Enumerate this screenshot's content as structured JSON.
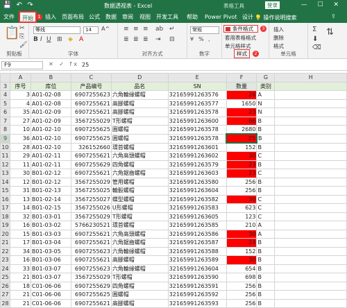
{
  "title_bar": {
    "quick_access": "💾 ↶ ↷",
    "title": "数据透视表 - Excel",
    "context_tool": "表格工具",
    "login": "登录",
    "window_controls": "— ☐ ✕"
  },
  "tabs": [
    "文件",
    "开始",
    "插入",
    "页面布局",
    "公式",
    "数据",
    "审阅",
    "视图",
    "开发工具",
    "帮助",
    "Power Pivot",
    "设计"
  ],
  "active_tab": "开始",
  "help": "操作说明搜索",
  "share_icon": "share-icon",
  "ribbon": {
    "font_name": "等线",
    "font_size": "14",
    "number_format": "常规",
    "groups": [
      "剪贴板",
      "字体",
      "对齐方式",
      "数字",
      "样式",
      "单元格"
    ],
    "conditional_format": "条件格式",
    "table_format": "套用表格格式",
    "cell_styles": "单元格样式",
    "insert": "插入",
    "delete": "删除",
    "format": "格式",
    "badges": [
      "1",
      "2",
      "3"
    ]
  },
  "formula_bar": {
    "name_box": "F9",
    "fx": "✕ ✓ fx",
    "value": "25"
  },
  "columns": [
    "",
    "A",
    "B",
    "C",
    "D",
    "E",
    "F",
    "G",
    "H"
  ],
  "header_row": {
    "num": "3",
    "cells": [
      "序号",
      "库位",
      "产品编号",
      "品名",
      "SN",
      "数量",
      "类别",
      ""
    ]
  },
  "rows": [
    {
      "n": "4",
      "c": [
        "3",
        "A01-02-08",
        "6907255623",
        "六角輪緣螺帽",
        "32165991263576",
        "26",
        "A",
        ""
      ],
      "red": true
    },
    {
      "n": "5",
      "c": [
        "4",
        "A01-02-08",
        "6907255621",
        "高腳螺帽",
        "32165991263577",
        "1650",
        "N",
        ""
      ],
      "red": false
    },
    {
      "n": "6",
      "c": [
        "35",
        "A01-02-09",
        "6907255621",
        "高腳螺帽",
        "32165991263578",
        "23",
        "N",
        ""
      ],
      "red": true
    },
    {
      "n": "7",
      "c": [
        "27",
        "A01-02-09",
        "3567255029",
        "T形螺帽",
        "32165991263600",
        "66",
        "B",
        ""
      ],
      "red": true
    },
    {
      "n": "8",
      "c": [
        "10",
        "A01-02-10",
        "6907255625",
        "圓螺帽",
        "32165991263578",
        "2680",
        "B",
        ""
      ],
      "red": false
    },
    {
      "n": "9",
      "c": [
        "36",
        "A01-02-10",
        "6907255625",
        "圓螺帽",
        "32165991263578",
        "25",
        "B",
        ""
      ],
      "red": true,
      "sel": true
    },
    {
      "n": "10",
      "c": [
        "28",
        "A01-02-10",
        "326152660",
        "環首螺帽",
        "32165991263601",
        "152",
        "B",
        ""
      ],
      "red": false
    },
    {
      "n": "11",
      "c": [
        "29",
        "A01-02-11",
        "6907255621",
        "六角高頭螺帽",
        "32165991263602",
        "30",
        "C",
        ""
      ],
      "red": true
    },
    {
      "n": "12",
      "c": [
        "11",
        "A01-02-11",
        "6907255629",
        "四角螺帽",
        "32165991263579",
        "23",
        "B",
        ""
      ],
      "red": true
    },
    {
      "n": "13",
      "c": [
        "30",
        "B01-02-12",
        "6907255621",
        "六角鋸齒螺帽",
        "32165991263603",
        "23",
        "C",
        ""
      ],
      "red": true
    },
    {
      "n": "14",
      "c": [
        "12",
        "B01-02-12",
        "3567255029",
        "管用螺帽",
        "32165991263580",
        "256",
        "B",
        ""
      ],
      "red": false
    },
    {
      "n": "15",
      "c": [
        "31",
        "B01-02-13",
        "3567255025",
        "輪轂螺帽",
        "32165991263604",
        "256",
        "B",
        ""
      ],
      "red": false
    },
    {
      "n": "16",
      "c": [
        "13",
        "B01-02-14",
        "3567255027",
        "蝶型螺帽",
        "32165991263582",
        "30",
        "C",
        ""
      ],
      "red": true
    },
    {
      "n": "17",
      "c": [
        "14",
        "B01-02-15",
        "3567255026",
        "U形螺帽",
        "32165991263583",
        "623",
        "C",
        ""
      ],
      "red": false
    },
    {
      "n": "18",
      "c": [
        "32",
        "B01-03-01",
        "3567255029",
        "T形螺帽",
        "32165991263605",
        "123",
        "C",
        ""
      ],
      "red": false
    },
    {
      "n": "19",
      "c": [
        "16",
        "B01-03-02",
        "5766230521",
        "環首螺帽",
        "32165991263585",
        "210",
        "A",
        ""
      ],
      "red": false
    },
    {
      "n": "20",
      "c": [
        "15",
        "B01-03-03",
        "6907255621",
        "六角高頭螺帽",
        "32165991263586",
        "30",
        "A",
        ""
      ],
      "red": true
    },
    {
      "n": "21",
      "c": [
        "17",
        "B01-03-04",
        "6907255621",
        "六角鋸齒螺帽",
        "32165991263587",
        "24",
        "B",
        ""
      ],
      "red": true
    },
    {
      "n": "22",
      "c": [
        "34",
        "B01-03-05",
        "6907255623",
        "六角輪緣螺帽",
        "32165991263588",
        "152",
        "B",
        ""
      ],
      "red": false
    },
    {
      "n": "23",
      "c": [
        "16",
        "B01-03-06",
        "6907255621",
        "高腳螺帽",
        "32165991263589",
        "30",
        "B",
        ""
      ],
      "red": true
    },
    {
      "n": "24",
      "c": [
        "33",
        "B01-03-07",
        "6907255623",
        "六角輪緣螺帽",
        "32165991263604",
        "654",
        "B",
        ""
      ],
      "red": false
    },
    {
      "n": "25",
      "c": [
        "21",
        "B01-03-07",
        "3567255029",
        "T形螺帽",
        "32165991263590",
        "698",
        "B",
        ""
      ],
      "red": false
    },
    {
      "n": "26",
      "c": [
        "18",
        "C01-06-06",
        "6907255629",
        "四角螺帽",
        "32165991263591",
        "256",
        "B",
        ""
      ],
      "red": false
    },
    {
      "n": "27",
      "c": [
        "21",
        "C01-06-06",
        "6907255625",
        "圓螺帽",
        "32165991263592",
        "256",
        "B",
        ""
      ],
      "red": false
    },
    {
      "n": "28",
      "c": [
        "21",
        "C01-06-06",
        "6907255621",
        "高腳螺帽",
        "32165991263593",
        "256",
        "B",
        ""
      ],
      "red": false
    }
  ]
}
